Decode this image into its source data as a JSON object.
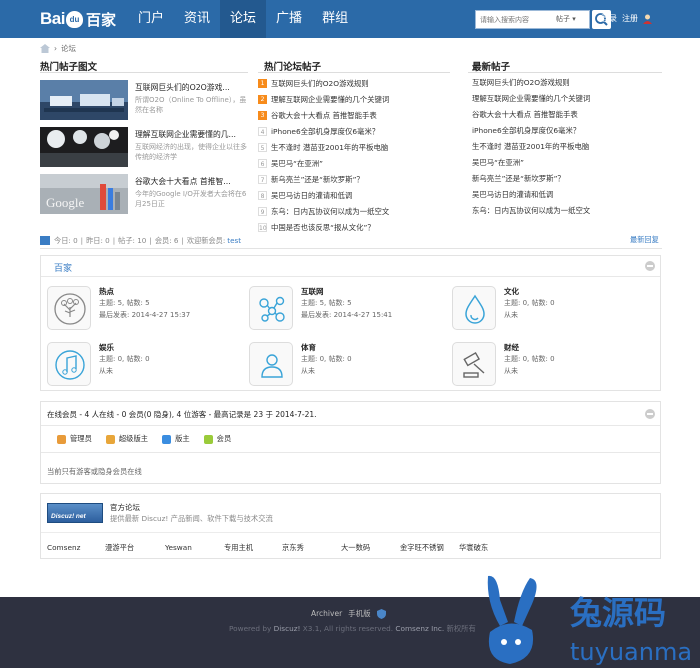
{
  "brand": {
    "logo_left": "Bai",
    "logo_mid": "du",
    "logo_right": "百家"
  },
  "nav": {
    "items": [
      {
        "label": "门户"
      },
      {
        "label": "资讯"
      },
      {
        "label": "论坛"
      },
      {
        "label": "广播"
      },
      {
        "label": "群组"
      }
    ],
    "active": "论坛"
  },
  "search": {
    "placeholder": "请输入搜索内容",
    "scope": "帖子 ▾"
  },
  "auth": {
    "login": "登录",
    "register": "注册"
  },
  "breadcrumb": {
    "current": "论坛"
  },
  "columns": {
    "pic_title": "热门帖子图文",
    "hot_title": "热门论坛帖子",
    "new_title": "最新帖子"
  },
  "pic_posts": [
    {
      "title": "互联网巨头们的O2O游戏...",
      "desc": "所谓O2O（Online To Offline），虽然在名称"
    },
    {
      "title": "理解互联网企业需要懂的几...",
      "desc": "互联网经济的出现，使得企业以往多传统的经济学"
    },
    {
      "title": "谷歌大会十大看点 首推智...",
      "desc": "今年的Google I/O开发者大会将在6月25日正"
    }
  ],
  "hot_posts": [
    {
      "num": "1",
      "title": "互联网巨头们的O2O游戏规则"
    },
    {
      "num": "2",
      "title": "理解互联网企业需要懂的几个关键词"
    },
    {
      "num": "3",
      "title": "谷歌大会十大看点 首推智能手表"
    },
    {
      "num": "4",
      "title": "iPhone6全部机身厚度仅6毫米？"
    },
    {
      "num": "5",
      "title": "生不逢时 潜苗亚2001年的平板电脑"
    },
    {
      "num": "6",
      "title": "吴巴马“在亚洲”"
    },
    {
      "num": "7",
      "title": "新乌亮兰”还是“新坎罗斯”？"
    },
    {
      "num": "8",
      "title": "吴巴马访日的灌请和低调"
    },
    {
      "num": "9",
      "title": "东乌：日内瓦协议何以成为一纸空文"
    },
    {
      "num": "10",
      "title": "中国是否也该反思“报从文化”？"
    }
  ],
  "new_posts": [
    {
      "title": "互联网巨头们的O2O游戏规则"
    },
    {
      "title": "理解互联网企业需要懂的几个关键词"
    },
    {
      "title": "谷歌大会十大看点 首推智能手表"
    },
    {
      "title": "iPhone6全部机身厚度仅6毫米？"
    },
    {
      "title": "生不逢时 潜苗亚2001年的平板电脑"
    },
    {
      "title": "吴巴马“在亚洲”"
    },
    {
      "title": "新乌亮兰”还是“新坎罗斯”？"
    },
    {
      "title": "吴巴马访日的灌请和低调"
    },
    {
      "title": "东乌：日内瓦协议何以成为一纸空文"
    }
  ],
  "stats": {
    "today": "今日: 0",
    "yesterday": "昨日: 0",
    "posts": "帖子: 10",
    "members": "会员: 6",
    "welcome": "欢迎新会员:",
    "new_user": "test",
    "latest_reply": "最新回复"
  },
  "category": {
    "title": "百家"
  },
  "forums": [
    {
      "name": "热点",
      "stat": "主题: 5, 帖数: 5",
      "last": "最后发表: 2014-4-27 15:37",
      "icon": "tree-icon"
    },
    {
      "name": "互联网",
      "stat": "主题: 5, 帖数: 5",
      "last": "最后发表: 2014-4-27 15:41",
      "icon": "network-icon"
    },
    {
      "name": "文化",
      "stat": "主题: 0, 帖数: 0",
      "last": "从未",
      "icon": "drop-icon"
    },
    {
      "name": "娱乐",
      "stat": "主题: 0, 帖数: 0",
      "last": "从未",
      "icon": "music-icon"
    },
    {
      "name": "体育",
      "stat": "主题: 0, 帖数: 0",
      "last": "从未",
      "icon": "person-icon"
    },
    {
      "name": "财经",
      "stat": "主题: 0, 帖数: 0",
      "last": "从未",
      "icon": "gavel-icon"
    }
  ],
  "online": {
    "summary": "在线会员 - 4 人在线 - 0 会员(0 隐身), 4 位游客 - 最高记录是 23 于 2014-7-21.",
    "legend": [
      {
        "label": "管理员",
        "color": "#e89b3a"
      },
      {
        "label": "超级版主",
        "color": "#e8a63a"
      },
      {
        "label": "版主",
        "color": "#3a8de0"
      },
      {
        "label": "会员",
        "color": "#9acb3a"
      }
    ],
    "none": "当前只有游客或隐身会员在线"
  },
  "links": {
    "logo": "Discuz! net",
    "title": "官方论坛",
    "desc": "提供最新 Discuz! 产品新闻、软件下载与技术交流",
    "items": [
      "Comsenz",
      "漫游平台",
      "Yeswan",
      "专用主机",
      "京东秀",
      "大一数码",
      "金字旺不锈钢",
      "华寰破东"
    ]
  },
  "footer": {
    "archiver": "Archiver",
    "mobile": "手机版",
    "powered_pre": "Powered by",
    "discuz": "Discuz!",
    "version": "X3.1",
    "rights": ", All rights reserved.",
    "company": "Comsenz Inc.",
    "extra": "新权所有"
  },
  "watermark": {
    "cn": "兔源码",
    "en": "tuyuanma"
  },
  "colors": {
    "header": "#2b6aa8",
    "link": "#3a7dc4",
    "footer": "#2e3140"
  }
}
